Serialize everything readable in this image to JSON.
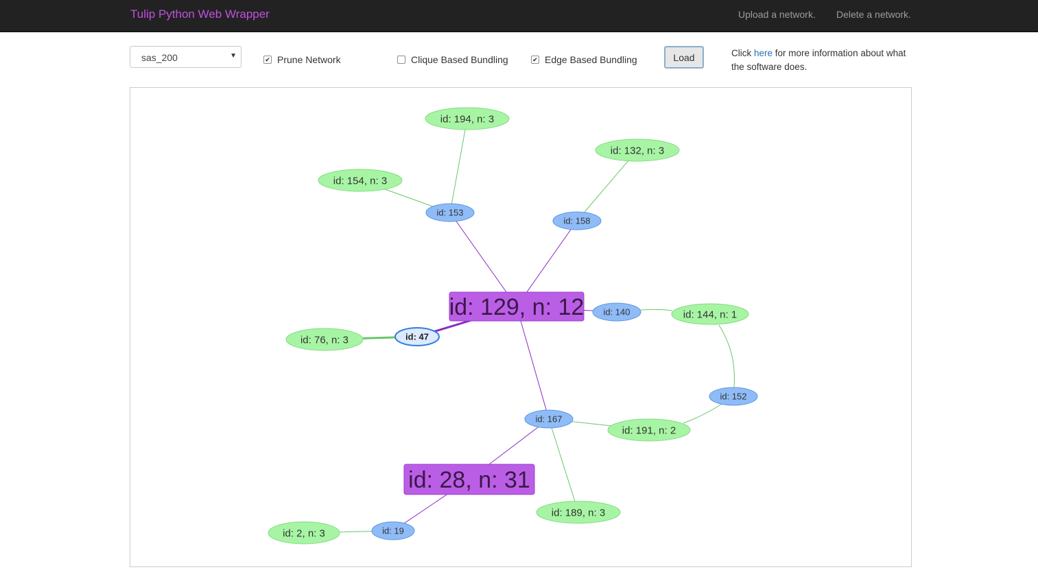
{
  "navbar": {
    "brand": "Tulip Python Web Wrapper",
    "upload_link": "Upload a network.",
    "delete_link": "Delete a network."
  },
  "controls": {
    "network_select": {
      "selected": "sas_200"
    },
    "prune_network": {
      "label": "Prune Network",
      "checked": true
    },
    "clique_bundling": {
      "label": "Clique Based Bundling",
      "checked": false
    },
    "edge_bundling": {
      "label": "Edge Based Bundling",
      "checked": true
    },
    "load_button": "Load",
    "info": {
      "prefix": "Click ",
      "link": "here",
      "suffix": " for more information about what the software does."
    }
  },
  "colors": {
    "navbar_bg": "#222222",
    "brand": "#c150e0",
    "big_node_fill": "#bb5ee6",
    "blue_node_fill": "#8fbcf7",
    "green_node_fill": "#a7f5a4",
    "purple_edge": "#8a2bc2",
    "green_edge": "#6cc46a",
    "selected_node_fill": "#dce9ff"
  },
  "graph": {
    "nodes": [
      {
        "id": "n194",
        "label": "id: 194, n: 3",
        "kind": "green"
      },
      {
        "id": "n132",
        "label": "id: 132, n: 3",
        "kind": "green"
      },
      {
        "id": "n154",
        "label": "id: 154, n: 3",
        "kind": "green"
      },
      {
        "id": "n153",
        "label": "id: 153",
        "kind": "blue"
      },
      {
        "id": "n158",
        "label": "id: 158",
        "kind": "blue"
      },
      {
        "id": "n129",
        "label": "id: 129, n: 12",
        "kind": "big"
      },
      {
        "id": "n140",
        "label": "id: 140",
        "kind": "blue"
      },
      {
        "id": "n144",
        "label": "id: 144, n: 1",
        "kind": "green"
      },
      {
        "id": "n76",
        "label": "id: 76, n: 3",
        "kind": "green"
      },
      {
        "id": "n47",
        "label": "id: 47",
        "kind": "selected"
      },
      {
        "id": "n152",
        "label": "id: 152",
        "kind": "blue"
      },
      {
        "id": "n167",
        "label": "id: 167",
        "kind": "blue"
      },
      {
        "id": "n191",
        "label": "id: 191, n: 2",
        "kind": "green"
      },
      {
        "id": "n28",
        "label": "id: 28, n: 31",
        "kind": "big"
      },
      {
        "id": "n189",
        "label": "id: 189, n: 3",
        "kind": "green"
      },
      {
        "id": "n2",
        "label": "id: 2, n: 3",
        "kind": "green"
      },
      {
        "id": "n19",
        "label": "id: 19",
        "kind": "blue"
      }
    ],
    "edges": [
      {
        "from": "n194",
        "to": "n153",
        "color": "green"
      },
      {
        "from": "n154",
        "to": "n153",
        "color": "green"
      },
      {
        "from": "n132",
        "to": "n158",
        "color": "green"
      },
      {
        "from": "n153",
        "to": "n129",
        "color": "purple"
      },
      {
        "from": "n158",
        "to": "n129",
        "color": "purple"
      },
      {
        "from": "n129",
        "to": "n140",
        "color": "purple"
      },
      {
        "from": "n140",
        "to": "n144",
        "color": "green"
      },
      {
        "from": "n144",
        "to": "n152",
        "color": "green"
      },
      {
        "from": "n152",
        "to": "n191",
        "color": "green"
      },
      {
        "from": "n129",
        "to": "n47",
        "color": "purple",
        "thick": true
      },
      {
        "from": "n76",
        "to": "n47",
        "color": "green",
        "thick": true
      },
      {
        "from": "n129",
        "to": "n167",
        "color": "purple"
      },
      {
        "from": "n167",
        "to": "n191",
        "color": "green"
      },
      {
        "from": "n167",
        "to": "n189",
        "color": "green"
      },
      {
        "from": "n167",
        "to": "n28",
        "color": "purple"
      },
      {
        "from": "n28",
        "to": "n19",
        "color": "purple"
      },
      {
        "from": "n2",
        "to": "n19",
        "color": "green"
      }
    ]
  }
}
